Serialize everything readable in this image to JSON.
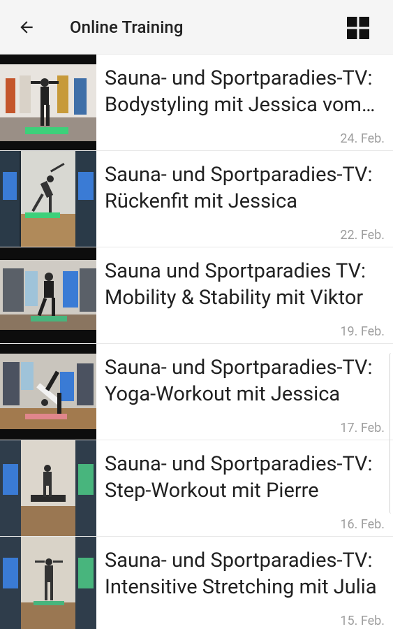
{
  "header": {
    "title": "Online Training",
    "back_icon": "arrow-left-icon",
    "grid_icon": "grid-view-icon"
  },
  "items": [
    {
      "title": "Sauna- und Sportparadies-TV: Bodystyling mit Jessica vom Sportparadies",
      "date": "24. Feb."
    },
    {
      "title": "Sauna- und Sportparadies-TV: Rückenfit mit Jessica",
      "date": "22. Feb."
    },
    {
      "title": "Sauna und Sportparadies TV: Mobility & Stability mit Viktor",
      "date": "19. Feb."
    },
    {
      "title": "Sauna- und Sportparadies-TV: Yoga-Workout mit Jessica",
      "date": "17. Feb."
    },
    {
      "title": "Sauna- und Sportparadies-TV: Step-Workout mit Pierre",
      "date": "16. Feb."
    },
    {
      "title": "Sauna- und Sportparadies-TV: Intensitive Stretching mit Julia",
      "date": "15. Feb."
    }
  ]
}
